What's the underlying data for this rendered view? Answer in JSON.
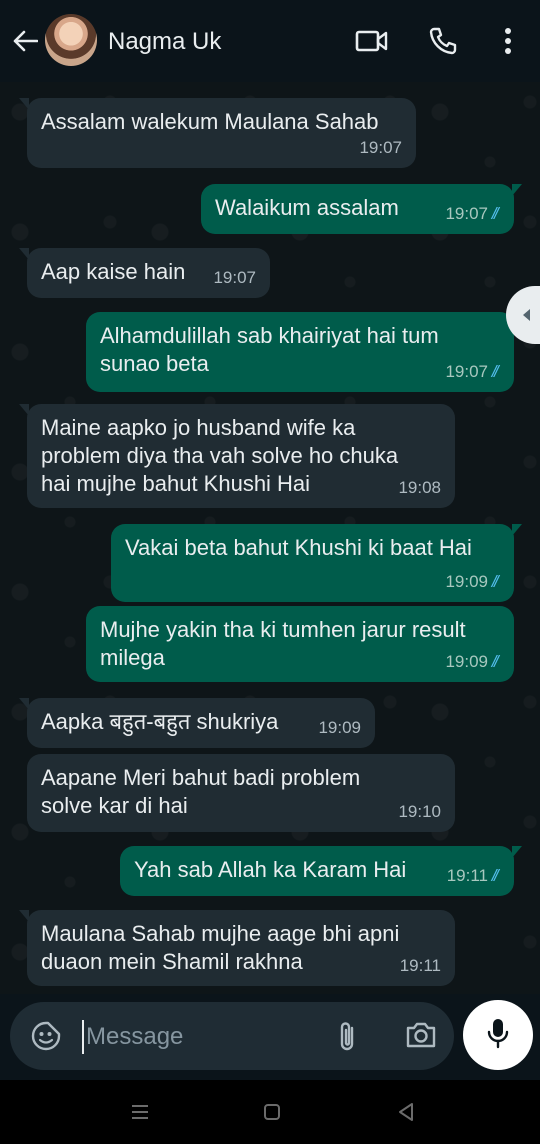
{
  "header": {
    "contact_name": "Nagma Uk",
    "icons": [
      "back-arrow-icon",
      "video-call-icon",
      "voice-call-icon",
      "more-options-icon"
    ]
  },
  "messages": [
    {
      "direction": "in",
      "text": "Assalam walekum Maulana Sahab",
      "time": "19:07",
      "ticks": ""
    },
    {
      "direction": "out",
      "text": "Walaikum assalam",
      "time": "19:07",
      "ticks": "//"
    },
    {
      "direction": "in",
      "text": "Aap kaise hain",
      "time": "19:07",
      "ticks": ""
    },
    {
      "direction": "out",
      "text": "Alhamdulillah sab khairiyat hai tum\nsunao beta",
      "time": "19:07",
      "ticks": "//"
    },
    {
      "direction": "in",
      "text": "Maine aapko jo husband wife ka\nproblem diya tha vah solve ho chuka\nhai mujhe bahut Khushi Hai",
      "time": "19:08",
      "ticks": ""
    },
    {
      "direction": "out",
      "text": "Vakai beta bahut Khushi ki baat Hai",
      "time": "19:09",
      "ticks": "//"
    },
    {
      "direction": "out",
      "text": "Mujhe yakin tha ki tumhen jarur result\nmilega",
      "time": "19:09",
      "ticks": "//"
    },
    {
      "direction": "in",
      "text": "Aapka बहुत-बहुत shukriya",
      "time": "19:09",
      "ticks": ""
    },
    {
      "direction": "in",
      "text": "Aapane Meri bahut badi problem\nsolve kar di hai",
      "time": "19:10",
      "ticks": ""
    },
    {
      "direction": "out",
      "text": "Yah sab Allah ka Karam Hai",
      "time": "19:11",
      "ticks": "//"
    },
    {
      "direction": "in",
      "text": "Maulana Sahab mujhe aage bhi apni\nduaon mein Shamil rakhna",
      "time": "19:11",
      "ticks": ""
    }
  ],
  "composer": {
    "placeholder": "Message",
    "icons": [
      "emoji-sticker-icon",
      "attach-icon",
      "camera-icon",
      "mic-icon"
    ]
  },
  "colors": {
    "background": "#0b141a",
    "incoming_bubble": "#202c33",
    "outgoing_bubble": "#005c4b",
    "read_tick": "#53bdeb"
  },
  "nav_icons": [
    "recent-apps-icon",
    "home-icon",
    "back-nav-icon"
  ]
}
